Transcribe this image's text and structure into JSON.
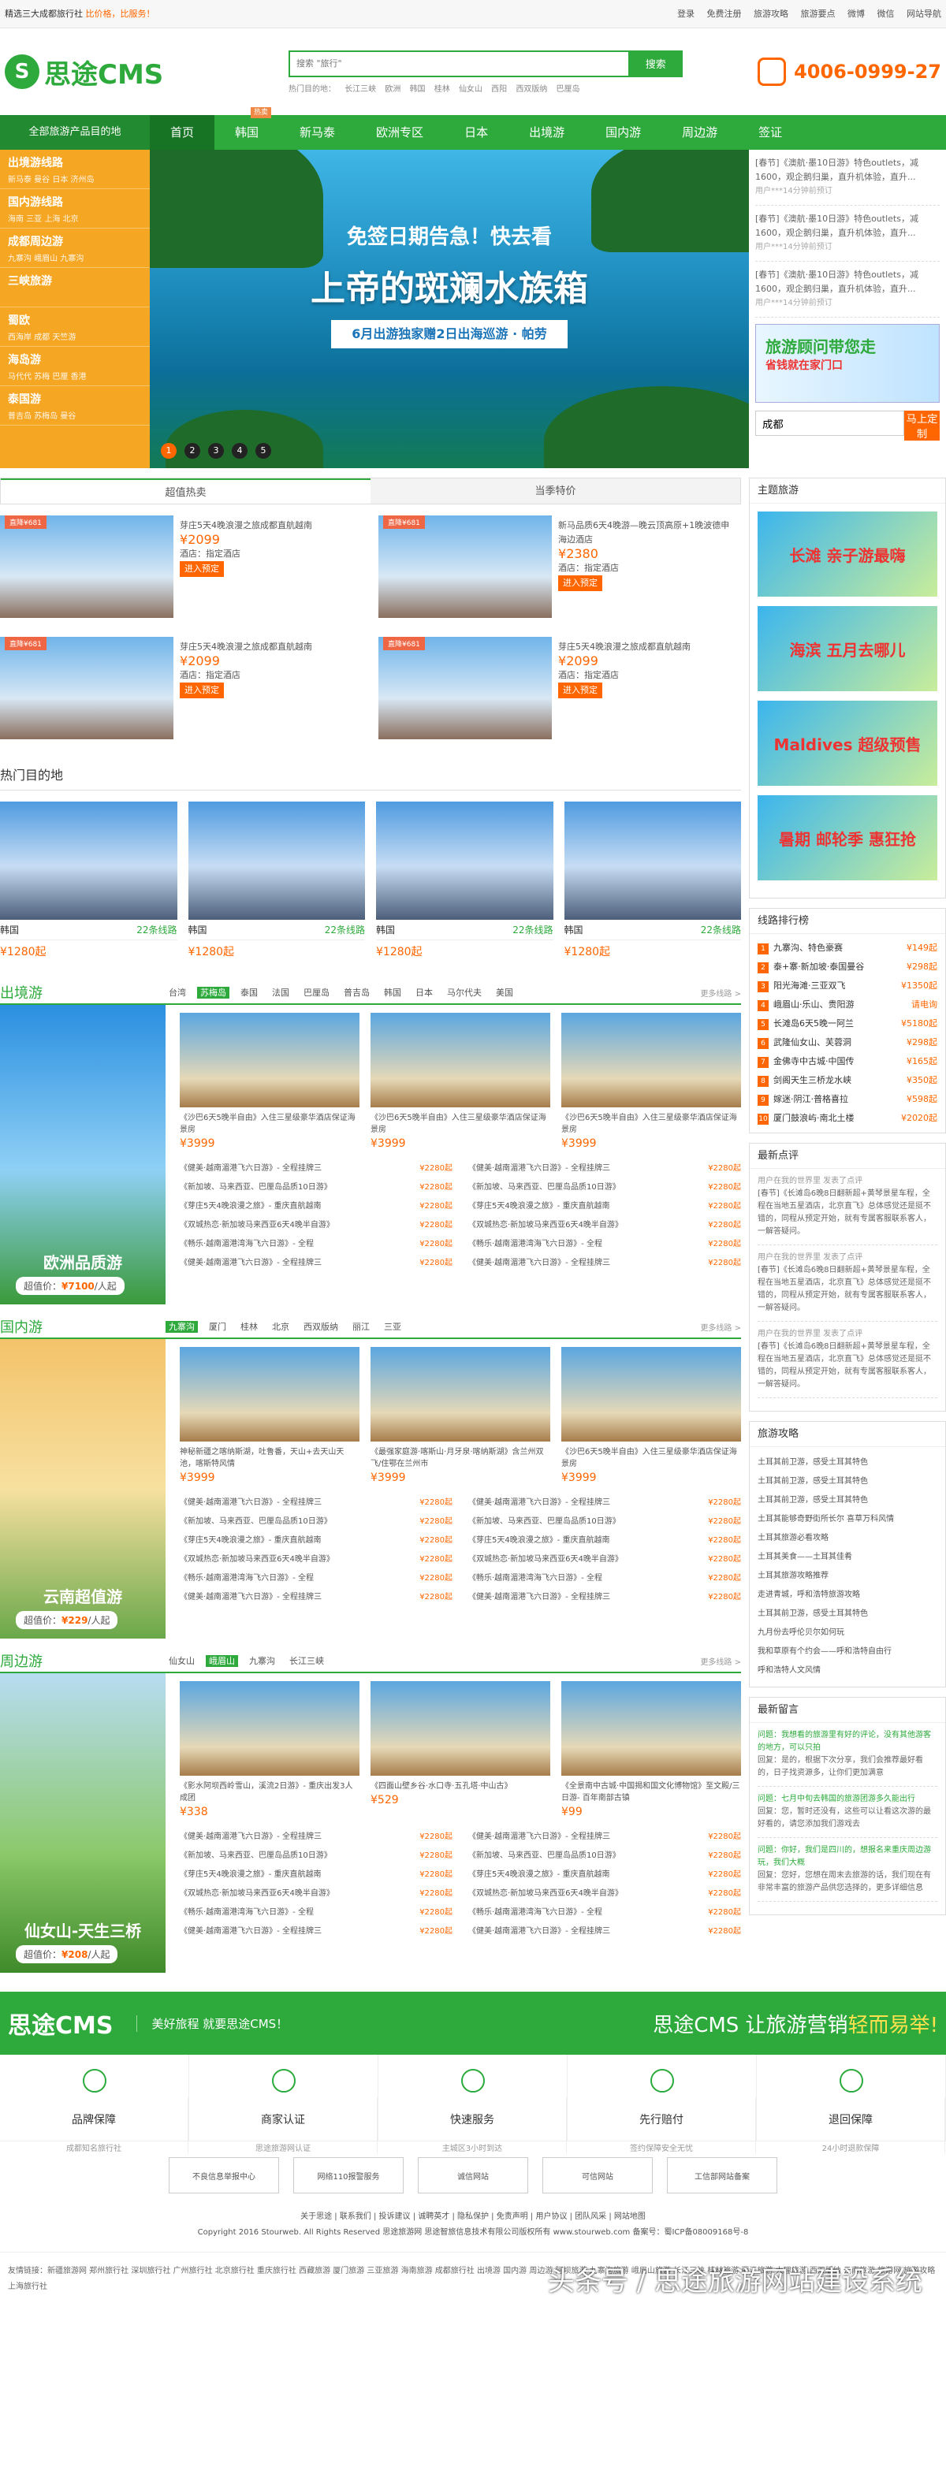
{
  "topbar": {
    "left": "精选三大成都旅行社",
    "left_hl": "比价格，比服务！",
    "links": [
      "登录",
      "免费注册",
      "旅游攻略",
      "旅游要点",
      "微博",
      "微信",
      "网站导航"
    ]
  },
  "logo": "思途CMS",
  "search": {
    "placeholder": "搜索 \"旅行\"",
    "button": "搜索",
    "hot_label": "热门目的地：",
    "hot": [
      "长江三峡",
      "欧洲",
      "韩国",
      "桂林",
      "仙女山",
      "西阳",
      "西双版纳",
      "巴厘岛"
    ]
  },
  "phone": "4006-0999-27",
  "nav": {
    "all": "全部旅游产品目的地",
    "items": [
      "首页",
      "韩国",
      "新马泰",
      "欧洲专区",
      "日本",
      "出境游",
      "国内游",
      "周边游",
      "签证"
    ],
    "hot_badge": "热卖"
  },
  "side": [
    {
      "t": "出境游线路",
      "s": "新马泰 曼谷 日本 济州岛"
    },
    {
      "t": "国内游线路",
      "s": "海南 三亚 上海 北京"
    },
    {
      "t": "成都周边游",
      "s": "九寨沟 峨眉山 九寨沟"
    },
    {
      "t": "三峡旅游",
      "s": ""
    },
    {
      "t": "蜀欧",
      "s": "西海岸 成都 天竺游"
    },
    {
      "t": "海岛游",
      "s": "马代代 苏梅 巴厘 香港"
    },
    {
      "t": "泰国游",
      "s": "普吉岛 苏梅岛 曼谷"
    }
  ],
  "banner": {
    "t1": "免签日期告急！快去看",
    "t2": "上帝的斑斓水族箱",
    "t3": "6月出游独家赠2日出海巡游 · 帕劳",
    "dots": [
      "1",
      "2",
      "3",
      "4",
      "5"
    ]
  },
  "news": [
    {
      "t": "[春节]《澳航·墨10日游》特色outlets，减1600，观企鹅归巢，直升机体验，直升...",
      "u": "用户***14分钟前预订"
    },
    {
      "t": "[春节]《澳航·墨10日游》特色outlets，减1600，观企鹅归巢，直升机体验，直升...",
      "u": "用户***14分钟前预订"
    },
    {
      "t": "[春节]《澳航·墨10日游》特色outlets，减1600，观企鹅归巢，直升机体验，直升...",
      "u": "用户***14分钟前预订"
    }
  ],
  "consult": {
    "t": "旅游顾问带您走",
    "s": "省钱就在家门口"
  },
  "city": {
    "value": "成都",
    "button": "马上定制"
  },
  "deal_tabs": [
    "超值热卖",
    "当季特价"
  ],
  "deals": [
    {
      "badge": "直降¥681",
      "title": "芽庄5天4晚浪漫之旅成都直航越南",
      "price": "2099",
      "hotel": "酒店：指定酒店",
      "btn": "进入预定"
    },
    {
      "badge": "直降¥681",
      "title": "新马品质6天4晚游—晚云顶高原+1晚波德申海边酒店",
      "price": "2380",
      "hotel": "酒店：指定酒店",
      "btn": "进入预定"
    },
    {
      "badge": "直降¥681",
      "title": "芽庄5天4晚浪漫之旅成都直航越南",
      "price": "2099",
      "hotel": "酒店：指定酒店",
      "btn": "进入预定"
    },
    {
      "badge": "直降¥681",
      "title": "芽庄5天4晚浪漫之旅成都直航越南",
      "price": "2099",
      "hotel": "酒店：指定酒店",
      "btn": "进入预定"
    }
  ],
  "hot_dest_title": "热门目的地",
  "dest": [
    {
      "n": "韩国",
      "c": "22条线路",
      "p": "¥1280起"
    },
    {
      "n": "韩国",
      "c": "22条线路",
      "p": "¥1280起"
    },
    {
      "n": "韩国",
      "c": "22条线路",
      "p": "¥1280起"
    },
    {
      "n": "韩国",
      "c": "22条线路",
      "p": "¥1280起"
    }
  ],
  "zones": [
    {
      "t": "出境游",
      "tags": [
        "台湾",
        "苏梅岛",
        "泰国",
        "法国",
        "巴厘岛",
        "普吉岛",
        "韩国",
        "日本",
        "马尔代夫",
        "美国"
      ],
      "on": 1,
      "more": "更多线路 >",
      "cap": "欧洲品质游",
      "pr_label": "超值价：",
      "pr": "¥7100",
      "pr_unit": "/人起",
      "cards": [
        {
          "d": "《沙巴6天5晚半自由》入住三星级豪华酒店保证海景房",
          "p": "¥3999"
        },
        {
          "d": "《沙巴6天5晚半自由》入住三星级豪华酒店保证海景房",
          "p": "¥3999"
        },
        {
          "d": "《沙巴6天5晚半自由》入住三星级豪华酒店保证海景房",
          "p": "¥3999"
        }
      ]
    },
    {
      "t": "国内游",
      "tags": [
        "九寨沟",
        "厦门",
        "桂林",
        "北京",
        "西双版纳",
        "丽江",
        "三亚"
      ],
      "on": 0,
      "more": "更多线路 >",
      "cap": "云南超值游",
      "pr_label": "超值价：",
      "pr": "¥229",
      "pr_unit": "/人起",
      "cards": [
        {
          "d": "神秘新疆之喀纳斯湖，吐鲁番，天山+去天山天池，喀斯特风情",
          "p": "¥3999"
        },
        {
          "d": "《最强家庭游·喀斯山·月牙泉·喀纳斯湖》含兰州双飞/住鄂在兰州市",
          "p": "¥3999"
        },
        {
          "d": "《沙巴6天5晚半自由》入住三星级豪华酒店保证海景房",
          "p": "¥3999"
        }
      ]
    },
    {
      "t": "周边游",
      "tags": [
        "仙女山",
        "峨眉山",
        "九寨沟",
        "长江三峡"
      ],
      "on": 1,
      "more": "更多线路 >",
      "cap": "仙女山-天生三桥",
      "pr_label": "超值价：",
      "pr": "¥208",
      "pr_unit": "/人起",
      "cards": [
        {
          "d": "《影水阿坝西岭雪山，溪流2日游》- 重庆出发3人成团",
          "p": "¥338"
        },
        {
          "d": "《四面山壁乡谷·水口寺·五孔塔·中山古》",
          "p": "¥529"
        },
        {
          "d": "《全景南中古城·中国揭和国文化博物馆》至文殿/三日游- 百年南部古镇",
          "p": "¥99"
        }
      ]
    }
  ],
  "zone_list": [
    [
      "《健美·越南湄港飞六日游》- 全程挂牌三",
      "¥2280起"
    ],
    [
      "《健美·越南湄港飞六日游》- 全程挂牌三",
      "¥2280起"
    ],
    [
      "《新加坡、马来西亚、巴厘岛品质10日游》",
      "¥2280起"
    ],
    [
      "《新加坡、马来西亚、巴厘岛品质10日游》",
      "¥2280起"
    ],
    [
      "《芽庄5天4晚浪漫之旅》- 重庆直航越南",
      "¥2280起"
    ],
    [
      "《芽庄5天4晚浪漫之旅》- 重庆直航越南",
      "¥2280起"
    ],
    [
      "《双城热恋·新加坡马来西亚6天4晚半自游》",
      "¥2280起"
    ],
    [
      "《双城热恋·新加坡马来西亚6天4晚半自游》",
      "¥2280起"
    ],
    [
      "《畅乐·越南湄港湾海飞六日游》- 全程",
      "¥2280起"
    ],
    [
      "《畅乐·越南湄港湾海飞六日游》- 全程",
      "¥2280起"
    ],
    [
      "《健美·越南湄港飞六日游》- 全程挂牌三",
      "¥2280起"
    ],
    [
      "《健美·越南湄港飞六日游》- 全程挂牌三",
      "¥2280起"
    ]
  ],
  "right": {
    "theme_title": "主题旅游",
    "themes": [
      "长滩 亲子游最嗨",
      "海滨 五月去哪儿",
      "Maldives 超级预售",
      "暑期 邮轮季 惠狂抢"
    ],
    "rank_title": "线路排行榜",
    "rank": [
      [
        "九寨沟、特色豪赛",
        "¥149起"
      ],
      [
        "泰+寨·新加坡·泰国曼谷",
        "¥298起"
      ],
      [
        "阳光海滩·三亚双飞",
        "¥1350起"
      ],
      [
        "峨眉山·乐山、贵阳游",
        "请电询"
      ],
      [
        "长滩岛6天5晚一阿兰",
        "¥5180起"
      ],
      [
        "武隆仙女山、芙蓉洞",
        "¥298起"
      ],
      [
        "金佛寺中古城·中国传",
        "¥165起"
      ],
      [
        "剑阁天生三桥龙水峡",
        "¥350起"
      ],
      [
        "嫁迷·阴江·普格喜拉",
        "¥598起"
      ],
      [
        "厦门鼓浪屿·南北土楼",
        "¥2020起"
      ]
    ],
    "review_title": "最新点评",
    "reviews": [
      {
        "u": "用户在我的世界里 发表了点评",
        "t": "[春节]《长滩岛6晚8日翻新超+黄琴景星车程，全程在当地五星酒店，北京直飞》总体感觉还是挺不错的，同程从预定开始，就有专属客服联系客人，一解答疑问。"
      },
      {
        "u": "用户在我的世界里 发表了点评",
        "t": "[春节]《长滩岛6晚8日翻新超+黄琴景星车程，全程在当地五星酒店，北京直飞》总体感觉还是挺不错的，同程从预定开始，就有专属客服联系客人，一解答疑问。"
      },
      {
        "u": "用户在我的世界里 发表了点评",
        "t": "[春节]《长滩岛6晚8日翻新超+黄琴景星车程，全程在当地五星酒店，北京直飞》总体感觉还是挺不错的，同程从预定开始，就有专属客服联系客人，一解答疑问。"
      }
    ],
    "guide_title": "旅游攻略",
    "guides": [
      "土耳其前卫游，感受土耳其特色",
      "土耳其前卫游，感受土耳其特色",
      "土耳其前卫游，感受土耳其特色",
      "土耳其能够奇野街所长尔 喜草万科风情",
      "土耳其旅游必看攻略",
      "土耳其美食——土耳其佳肴",
      "土耳其旅游攻略推荐",
      "走进青城，呼和浩特旅游攻略",
      "土耳其前卫游，感受土耳其特色",
      "九月份去呼伦贝尔如何玩",
      "我和草原有个约会——呼和浩特自由行",
      "呼和浩特人文风情"
    ],
    "msg_title": "最新留言",
    "msgs": [
      {
        "q": "问题：我想看的旅游里有好的评论，没有其他游客的地方，可以只拍",
        "a": "回复：是的，根据下次分享，我们会推荐最好看的，日子找资源多，让你们更加满意"
      },
      {
        "q": "问题：七月中旬去韩国的旅游团游多久能出行",
        "a": "回复：您，暂时还没有，这些可以让看这次游的最好看的，请您添加我们游戏去"
      },
      {
        "q": "问题：你好，我们是四川的，想报名来重庆周边游玩，我们大概",
        "a": "回复：您好，您想在周末去旅游的话，我们现在有非常丰富的旅游产品供您选择的，更多详细信息"
      }
    ]
  },
  "footer": {
    "logo": "思途CMS",
    "slogan": "美好旅程 就要思途CMS！",
    "tagline_a": "思途CMS 让旅游营销",
    "tagline_b": "轻而易举!",
    "services": [
      {
        "t": "品牌保障",
        "s": "成都知名旅行社"
      },
      {
        "t": "商家认证",
        "s": "思途旅游网认证"
      },
      {
        "t": "快速服务",
        "s": "主城区3小时到达"
      },
      {
        "t": "先行赔付",
        "s": "签约保障安全无忧"
      },
      {
        "t": "退回保障",
        "s": "24小时退款保障"
      }
    ],
    "certs": [
      "不良信息举报中心",
      "网络110报警服务",
      "诚信网站",
      "可信网站",
      "工信部网站备案"
    ],
    "links": "关于思途 | 联系我们 | 投诉建议 | 诚聘英才 | 隐私保护 | 免责声明 | 用户协议 | 团队风采 | 网站地图",
    "copyright": "Copyright 2016 Stourweb. All Rights Reserved 思途旅游网 思途智旅信息技术有限公司版权所有 www.stourweb.com 备案号：蜀ICP备08009168号-8",
    "friends": "友情链接：新疆旅游网 郑州旅行社 深圳旅行社 广州旅行社 北京旅行社 重庆旅行社 西藏旅游 厦门旅游 三亚旅游 海南旅游 成都旅行社 出境游 国内游 周边游 阿坝旅游 九寨沟旅游 峨眉山旅游 长江三峡 桂林旅游 丽江旅游 大理旅游 西双版纳 云南旅游 旅游网 旅游攻略 上海旅行社",
    "watermark": "头条号 / 思途旅游网站建设系统"
  }
}
